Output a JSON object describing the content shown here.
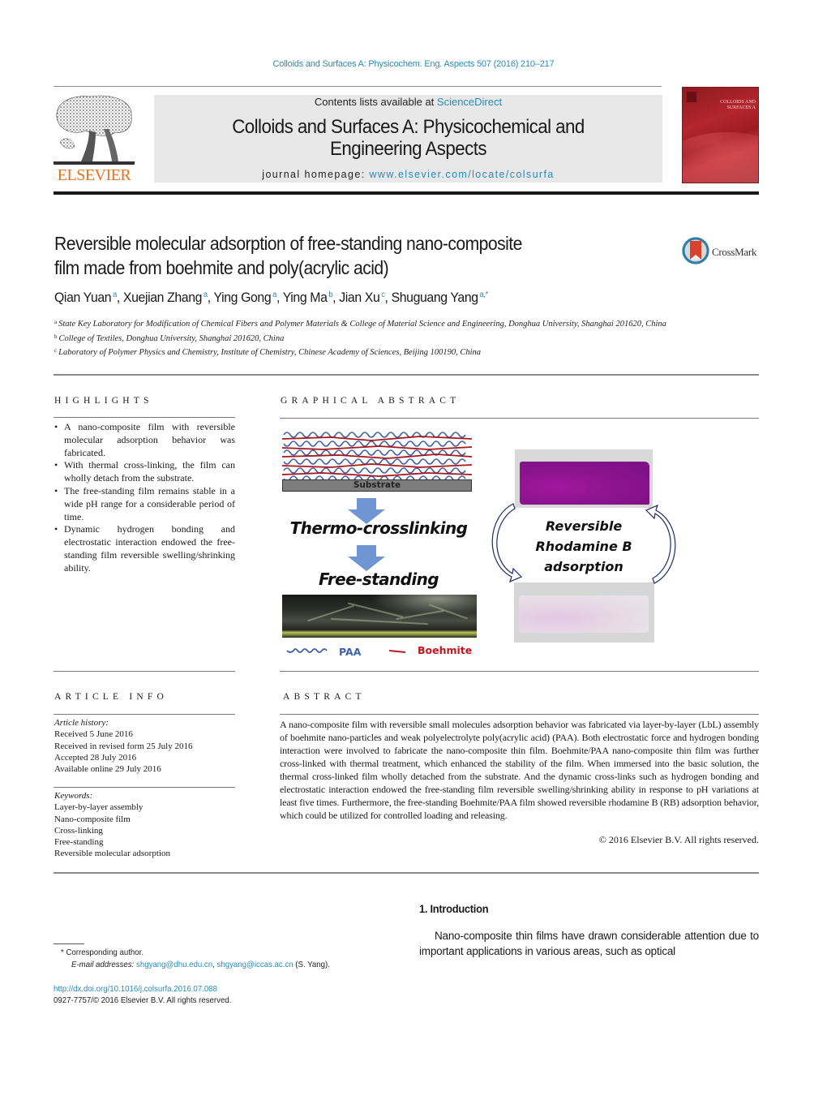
{
  "header": {
    "citation": "Colloids and Surfaces A: Physicochem. Eng. Aspects 507 (2016) 210–217",
    "contents_prefix": "Contents lists available at ",
    "contents_link": "ScienceDirect",
    "journal_title_line1": "Colloids and Surfaces A: Physicochemical and",
    "journal_title_line2": "Engineering Aspects",
    "homepage_prefix": "journal homepage: ",
    "homepage_link": "www.elsevier.com/locate/colsurfa",
    "publisher_wordmark": "ELSEVIER",
    "cover_title": "COLLOIDS AND SURFACES A",
    "colors": {
      "link": "#2a8ab8",
      "elsevier_orange": "#e9711c",
      "banner_bg": "#e8e8e8",
      "cover_red": "#b3262c"
    }
  },
  "article": {
    "title_line1": "Reversible molecular adsorption of free-standing nano-composite",
    "title_line2": "film made from boehmite and poly(acrylic acid)",
    "crossmark_label": "CrossMark",
    "authors": [
      {
        "name": "Qian Yuan",
        "affil": "a"
      },
      {
        "name": "Xuejian Zhang",
        "affil": "a"
      },
      {
        "name": "Ying Gong",
        "affil": "a"
      },
      {
        "name": "Ying Ma",
        "affil": "b"
      },
      {
        "name": "Jian Xu",
        "affil": "c"
      },
      {
        "name": "Shuguang Yang",
        "affil": "a,*"
      }
    ],
    "affiliations": [
      {
        "mark": "a",
        "text": "State Key Laboratory for Modification of Chemical Fibers and Polymer Materials & College of Material Science and Engineering, Donghua University, Shanghai 201620, China"
      },
      {
        "mark": "b",
        "text": "College of Textiles, Donghua University, Shanghai 201620, China"
      },
      {
        "mark": "c",
        "text": "Laboratory of Polymer Physics and Chemistry, Institute of Chemistry, Chinese Academy of Sciences, Beijing 100190, China"
      }
    ]
  },
  "highlights": {
    "heading": "HIGHLIGHTS",
    "items": [
      "A nano-composite film with reversible molecular adsorption behavior was fabricated.",
      "With thermal cross-linking, the film can wholly detach from the substrate.",
      "The free-standing film remains stable in a wide pH range for a considerable period of time.",
      "Dynamic hydrogen bonding and electrostatic interaction endowed the free-standing film reversible swelling/shrinking ability."
    ]
  },
  "graphical_abstract": {
    "heading": "GRAPHICAL ABSTRACT",
    "substrate_label": "Substrate",
    "step1_label": "Thermo-crosslinking",
    "step2_label": "Free-standing",
    "cycle_label_line1": "Reversible",
    "cycle_label_line2": "Rhodamine B",
    "cycle_label_line3": "adsorption",
    "legend_paa": "PAA",
    "legend_boehmite": "Boehmite",
    "colors": {
      "paa": "#3a63b0",
      "boehmite": "#c0161c",
      "arrow": "#6f95d2",
      "stained_film": "#8c148e",
      "cycle_arrow": "#1b2a6b"
    }
  },
  "article_info": {
    "heading": "ARTICLE INFO",
    "history_label": "Article history:",
    "history": [
      "Received 5 June 2016",
      "Received in revised form 25 July 2016",
      "Accepted 28 July 2016",
      "Available online 29 July 2016"
    ],
    "keywords_label": "Keywords:",
    "keywords": [
      "Layer-by-layer assembly",
      "Nano-composite film",
      "Cross-linking",
      "Free-standing",
      "Reversible molecular adsorption"
    ]
  },
  "abstract": {
    "heading": "ABSTRACT",
    "text": "A nano-composite film with reversible small molecules adsorption behavior was fabricated via layer-by-layer (LbL) assembly of boehmite nano-particles and weak polyelectrolyte poly(acrylic acid) (PAA). Both electrostatic force and hydrogen bonding interaction were involved to fabricate the nano-composite thin film. Boehmite/PAA nano-composite thin film was further cross-linked with thermal treatment, which enhanced the stability of the film. When immersed into the basic solution, the thermal cross-linked film wholly detached from the substrate. And the dynamic cross-links such as hydrogen bonding and electrostatic interaction endowed the free-standing film reversible swelling/shrinking ability in response to pH variations at least five times. Furthermore, the free-standing Boehmite/PAA film showed reversible rhodamine B (RB) adsorption behavior, which could be utilized for controlled loading and releasing.",
    "copyright": "© 2016 Elsevier B.V. All rights reserved."
  },
  "introduction": {
    "heading": "1.  Introduction",
    "text": "Nano-composite thin films have drawn considerable attention due to important applications in various areas, such as optical"
  },
  "footnotes": {
    "corresponding": "*  Corresponding author.",
    "email_label": "E-mail addresses:",
    "emails": [
      "shgyang@dhu.edu.cn",
      "shgyang@iccas.ac.cn"
    ],
    "email_suffix": " (S. Yang).",
    "doi": "http://dx.doi.org/10.1016/j.colsurfa.2016.07.088",
    "issn": "0927-7757/© 2016 Elsevier B.V. All rights reserved."
  }
}
